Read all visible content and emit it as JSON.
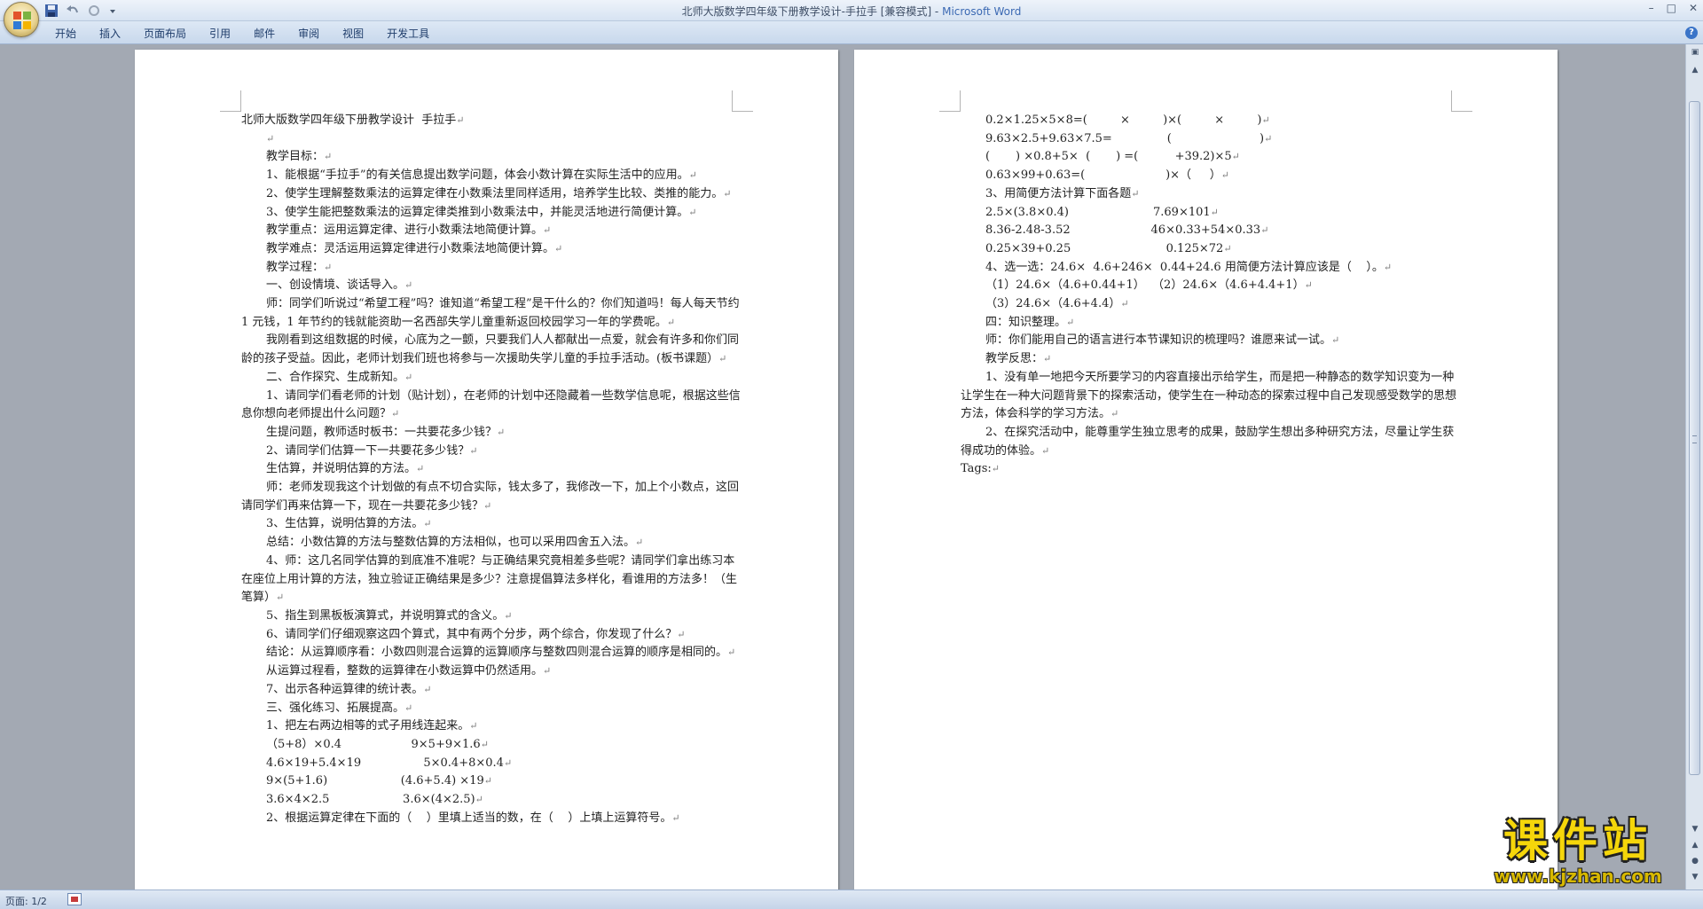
{
  "window": {
    "title": "北师大版数学四年级下册教学设计-手拉手 [兼容模式] - ",
    "app": "Microsoft Word",
    "controls": [
      "–",
      "□",
      "✕"
    ]
  },
  "quick_access": [
    "save-icon",
    "undo-icon",
    "redo-icon",
    "customize-icon"
  ],
  "ribbon": {
    "tabs": [
      "开始",
      "插入",
      "页面布局",
      "引用",
      "邮件",
      "审阅",
      "视图",
      "开发工具"
    ]
  },
  "page1": {
    "lines": [
      {
        "t": "北师大版数学四年级下册教学设计  手拉手",
        "s": ""
      },
      {
        "t": "",
        "s": "ind"
      },
      {
        "t": "教学目标：",
        "s": "ind"
      },
      {
        "t": "1、能根据“手拉手”的有关信息提出数学问题，体会小数计算在实际生活中的应用。",
        "s": "ind"
      },
      {
        "t": "2、使学生理解整数乘法的运算定律在小数乘法里同样适用，培养学生比较、类推的能力。",
        "s": "ind"
      },
      {
        "t": "3、使学生能把整数乘法的运算定律类推到小数乘法中，并能灵活地进行简便计算。",
        "s": "ind"
      },
      {
        "t": "教学重点：运用运算定律、进行小数乘法地简便计算。",
        "s": "ind"
      },
      {
        "t": "教学难点：灵活运用运算定律进行小数乘法地简便计算。",
        "s": "ind"
      },
      {
        "t": "教学过程：",
        "s": "ind"
      },
      {
        "t": "一、创设情境、谈话导入。",
        "s": "ind"
      },
      {
        "t": "师：同学们听说过“希望工程”吗？谁知道“希望工程”是干什么的？你们知道吗！每人每天节约 1 元钱，1 年节约的钱就能资助一名西部失学儿童重新返回校园学习一年的学费呢。",
        "s": "ind"
      },
      {
        "t": "我刚看到这组数据的时候，心底为之一颤，只要我们人人都献出一点爱，就会有许多和你们同龄的孩子受益。因此，老师计划我们班也将参与一次援助失学儿童的手拉手活动。(板书课题）",
        "s": "ind"
      },
      {
        "t": "二、合作探究、生成新知。",
        "s": "ind"
      },
      {
        "t": "1、请同学们看老师的计划（贴计划），在老师的计划中还隐藏着一些数学信息呢，根据这些信息你想向老师提出什么问题？",
        "s": "ind"
      },
      {
        "t": "生提问题，教师适时板书：一共要花多少钱？",
        "s": "ind"
      },
      {
        "t": "2、请同学们估算一下一共要花多少钱？",
        "s": "ind"
      },
      {
        "t": "生估算，并说明估算的方法。",
        "s": "ind"
      },
      {
        "t": "师：老师发现我这个计划做的有点不切合实际，钱太多了，我修改一下，加上个小数点，这回请同学们再来估算一下，现在一共要花多少钱？",
        "s": "ind"
      },
      {
        "t": "3、生估算，说明估算的方法。",
        "s": "ind"
      },
      {
        "t": "总结：小数估算的方法与整数估算的方法相似，也可以采用四舍五入法。",
        "s": "ind"
      },
      {
        "t": "4、师：这几名同学估算的到底准不准呢？与正确结果究竟相差多些呢？请同学们拿出练习本在座位上用计算的方法，独立验证正确结果是多少？注意提倡算法多样化，看谁用的方法多！（生笔算）",
        "s": "ind"
      },
      {
        "t": "5、指生到黑板板演算式，并说明算式的含义。",
        "s": "ind"
      },
      {
        "t": "6、请同学们仔细观察这四个算式，其中有两个分步，两个综合，你发现了什么？",
        "s": "ind"
      },
      {
        "t": "结论：从运算顺序看：小数四则混合运算的运算顺序与整数四则混合运算的顺序是相同的。",
        "s": "ind"
      },
      {
        "t": "从运算过程看，整数的运算律在小数运算中仍然适用。",
        "s": "ind"
      },
      {
        "t": "7、出示各种运算律的统计表。",
        "s": "ind"
      },
      {
        "t": "三、强化练习、拓展提高。",
        "s": "ind"
      },
      {
        "t": "1、把左右两边相等的式子用线连起来。",
        "s": "ind"
      },
      {
        "t": "（5+8）×0.4                   9×5+9×1.6",
        "s": "ind2"
      },
      {
        "t": "4.6×19+5.4×19                 5×0.4+8×0.4",
        "s": "ind2"
      },
      {
        "t": "9×(5+1.6)                    (4.6+5.4) ×19",
        "s": "ind2"
      },
      {
        "t": "3.6×4×2.5                    3.6×(4×2.5)",
        "s": "ind2"
      },
      {
        "t": "2、根据运算定律在下面的（    ）里填上适当的数，在（    ）上填上运算符号。",
        "s": "ind"
      }
    ]
  },
  "page2": {
    "lines": [
      {
        "t": "0.2×1.25×5×8=(         ×         )×(         ×         )",
        "s": "ind"
      },
      {
        "t": "9.63×2.5+9.63×7.5=               (                        )",
        "s": "ind"
      },
      {
        "t": "(       ) ×0.8+5×  (       ) =(          +39.2)×5",
        "s": "ind"
      },
      {
        "t": "0.63×99+0.63=(                      )×（     ）",
        "s": "ind"
      },
      {
        "t": "3、用简便方法计算下面各题",
        "s": "ind"
      },
      {
        "t": "2.5×(3.8×0.4)                       7.69×101",
        "s": "ind"
      },
      {
        "t": "8.36-2.48-3.52                      46×0.33+54×0.33",
        "s": "ind"
      },
      {
        "t": "0.25×39+0.25                          0.125×72",
        "s": "ind"
      },
      {
        "t": "4、选一选：24.6×  4.6+246×  0.44+24.6 用简便方法计算应该是（    ）。",
        "s": "ind"
      },
      {
        "t": "（1）24.6×（4.6+0.44+1）  （2）24.6×（4.6+4.4+1）",
        "s": "ind"
      },
      {
        "t": "（3）24.6×（4.6+4.4）",
        "s": "ind"
      },
      {
        "t": "四：知识整理。",
        "s": "ind"
      },
      {
        "t": "师：你们能用自己的语言进行本节课知识的梳理吗？谁愿来试一试。",
        "s": "ind"
      },
      {
        "t": "教学反思：",
        "s": "ind"
      },
      {
        "t": "1、没有单一地把今天所要学习的内容直接出示给学生，而是把一种静态的数学知识变为一种让学生在一种大问题背景下的探索活动，使学生在一种动态的探索过程中自己发现感受数学的思想方法，体会科学的学习方法。",
        "s": "ind"
      },
      {
        "t": "2、在探究活动中，能尊重学生独立思考的成果，鼓励学生想出多种研究方法，尽量让学生获得成功的体验。",
        "s": "ind"
      },
      {
        "t": "Tags:",
        "s": ""
      }
    ]
  },
  "paragraph_mark": "↵",
  "statusbar": {
    "page": "页面: 1/2"
  },
  "watermark": {
    "main": "课件站",
    "url": "www.kjzhan.com"
  }
}
